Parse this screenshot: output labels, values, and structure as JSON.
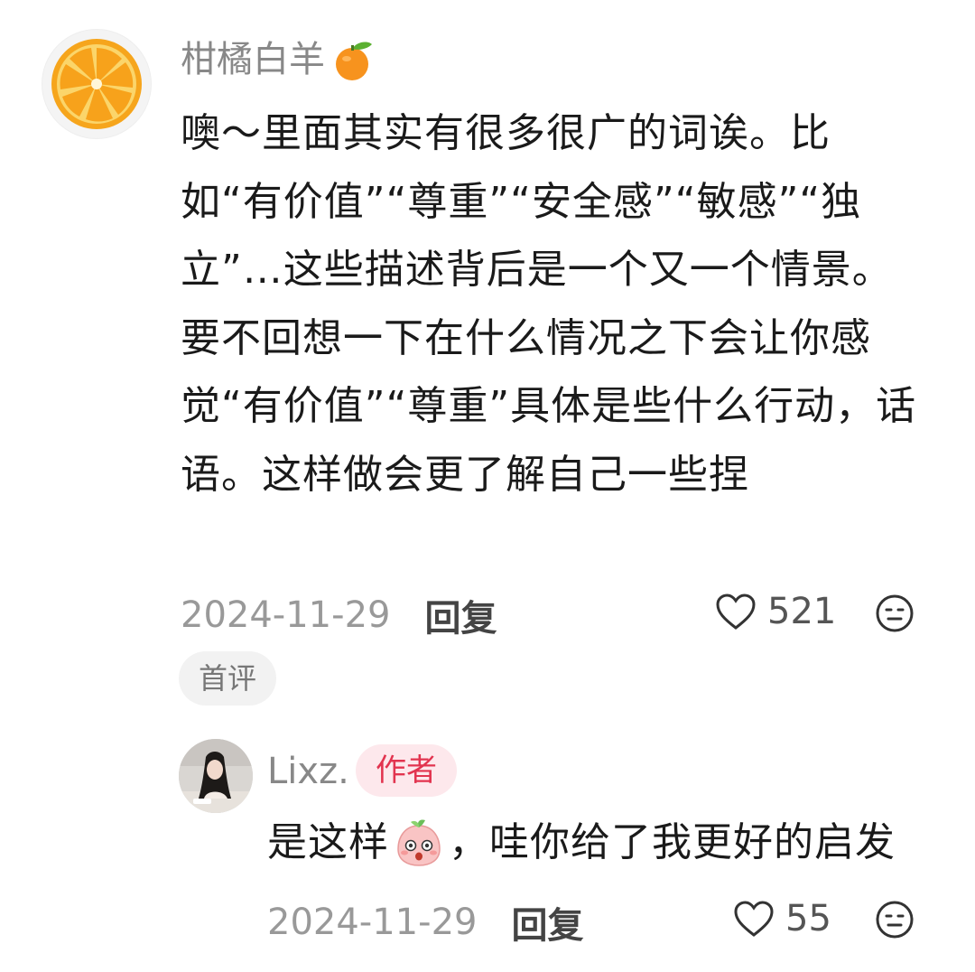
{
  "comment": {
    "username": "柑橘白羊",
    "body": "噢～里面其实有很多很广的词诶。比如“有价值”“尊重”“安全感”“敏感”“独立”…这些描述背后是一个又一个情景。要不回想一下在什么情况之下会让你感觉“有价值”“尊重”具体是些什么行动，话语。这样做会更了解自己一些捏",
    "date": "2024-11-29",
    "reply_label": "回复",
    "likes": "521",
    "first_badge": "首评"
  },
  "reply": {
    "username": "Lixz.",
    "author_badge": "作者",
    "text_before": "是这样",
    "text_after": "，哇你给了我更好的启发",
    "date": "2024-11-29",
    "reply_label": "回复",
    "likes": "55"
  },
  "colors": {
    "author_badge_bg": "#fde8ec",
    "author_badge_text": "#e2344f"
  }
}
